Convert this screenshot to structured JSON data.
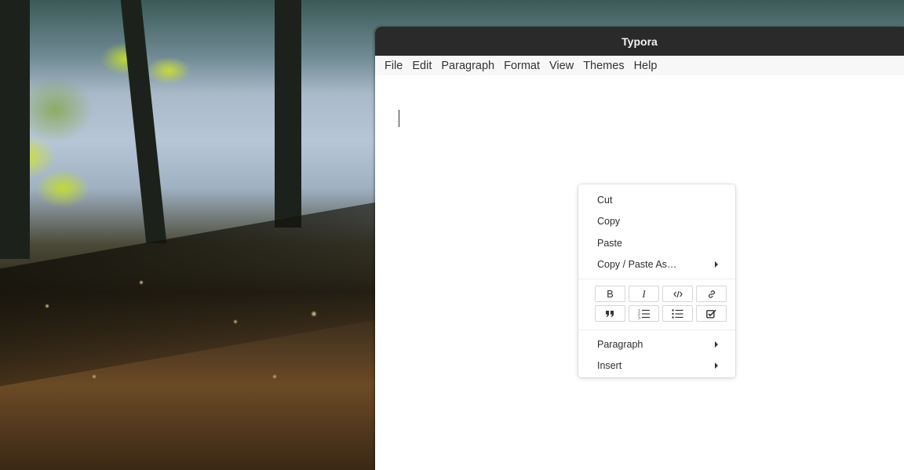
{
  "window": {
    "title": "Typora"
  },
  "menubar": {
    "items": [
      "File",
      "Edit",
      "Paragraph",
      "Format",
      "View",
      "Themes",
      "Help"
    ]
  },
  "context_menu": {
    "top_items": [
      {
        "label": "Cut",
        "submenu": false
      },
      {
        "label": "Copy",
        "submenu": false
      },
      {
        "label": "Paste",
        "submenu": false
      },
      {
        "label": "Copy / Paste As…",
        "submenu": true
      }
    ],
    "format_buttons": [
      {
        "icon": "bold-icon",
        "glyph": "B"
      },
      {
        "icon": "italic-icon",
        "glyph": "I"
      },
      {
        "icon": "code-icon",
        "glyph": ""
      },
      {
        "icon": "link-icon",
        "glyph": ""
      },
      {
        "icon": "quote-icon",
        "glyph": ""
      },
      {
        "icon": "ordered-list-icon",
        "glyph": ""
      },
      {
        "icon": "unordered-list-icon",
        "glyph": ""
      },
      {
        "icon": "task-list-icon",
        "glyph": ""
      }
    ],
    "bottom_items": [
      {
        "label": "Paragraph",
        "submenu": true
      },
      {
        "label": "Insert",
        "submenu": true
      }
    ]
  }
}
